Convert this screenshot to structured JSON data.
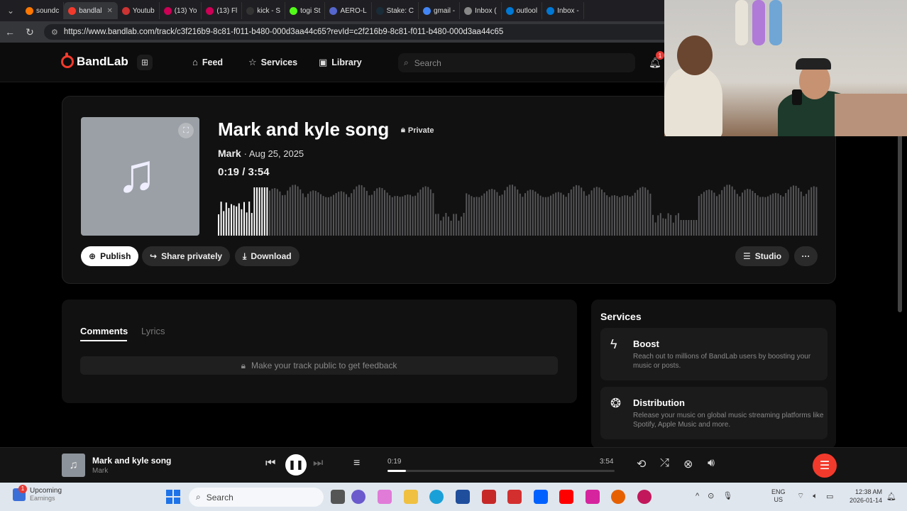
{
  "browser": {
    "tabs": [
      {
        "label": "soundc",
        "color": "#ff7700"
      },
      {
        "label": "bandlal",
        "color": "#f23a2c"
      },
      {
        "label": "Youtub",
        "color": "#cc3333"
      },
      {
        "label": "(13) Yo",
        "color": "#cc0055"
      },
      {
        "label": "(13) Fl",
        "color": "#cc0055"
      },
      {
        "label": "kick - S",
        "color": "#333333"
      },
      {
        "label": "togi St",
        "color": "#53fc18"
      },
      {
        "label": "AERO-L",
        "color": "#5566cc"
      },
      {
        "label": "Stake: C",
        "color": "#1a2c38"
      },
      {
        "label": "gmail -",
        "color": "#4285f4"
      },
      {
        "label": "Inbox (",
        "color": "#888888"
      },
      {
        "label": "outlool",
        "color": "#0078d4"
      },
      {
        "label": "Inbox -",
        "color": "#0078d4"
      }
    ],
    "url": "https://www.bandlab.com/track/c3f216b9-8c81-f011-b480-000d3aa44c65?revId=c2f216b9-8c81-f011-b480-000d3aa44c65"
  },
  "header": {
    "logo": "BandLab",
    "nav": [
      {
        "label": "Feed",
        "icon": "home-icon"
      },
      {
        "label": "Services",
        "icon": "star-icon"
      },
      {
        "label": "Library",
        "icon": "library-icon"
      }
    ],
    "search_placeholder": "Search",
    "notification_count": "1"
  },
  "track": {
    "title": "Mark and kyle song",
    "visibility": "Private",
    "artist": "Mark",
    "date": "Aug 25, 2025",
    "current_time": "0:19",
    "duration": "3:54",
    "progress_fraction": 0.081,
    "actions": {
      "publish": "Publish",
      "share": "Share privately",
      "download": "Download",
      "studio": "Studio",
      "more": "···"
    }
  },
  "comments": {
    "tabs": [
      "Comments",
      "Lyrics"
    ],
    "notice": "Make your track public to get feedback"
  },
  "services": {
    "title": "Services",
    "items": [
      {
        "name": "Boost",
        "description": "Reach out to millions of BandLab users by boosting your music or posts.",
        "icon": "bolt-icon"
      },
      {
        "name": "Distribution",
        "description": "Release your music on global music streaming platforms like Spotify, Apple Music and more.",
        "icon": "distribution-icon"
      }
    ]
  },
  "player": {
    "title": "Mark and kyle song",
    "artist": "Mark",
    "current_time": "0:19",
    "duration": "3:54"
  },
  "taskbar": {
    "weather_title": "Upcoming",
    "weather_sub": "Earnings",
    "weather_badge": "1",
    "search": "Search",
    "lang_top": "ENG",
    "lang_bottom": "US",
    "time": "12:38 AM",
    "date": "2026-01-14"
  },
  "colors": {
    "brand": "#f23a2c",
    "background": "#000000",
    "card": "#111111"
  }
}
